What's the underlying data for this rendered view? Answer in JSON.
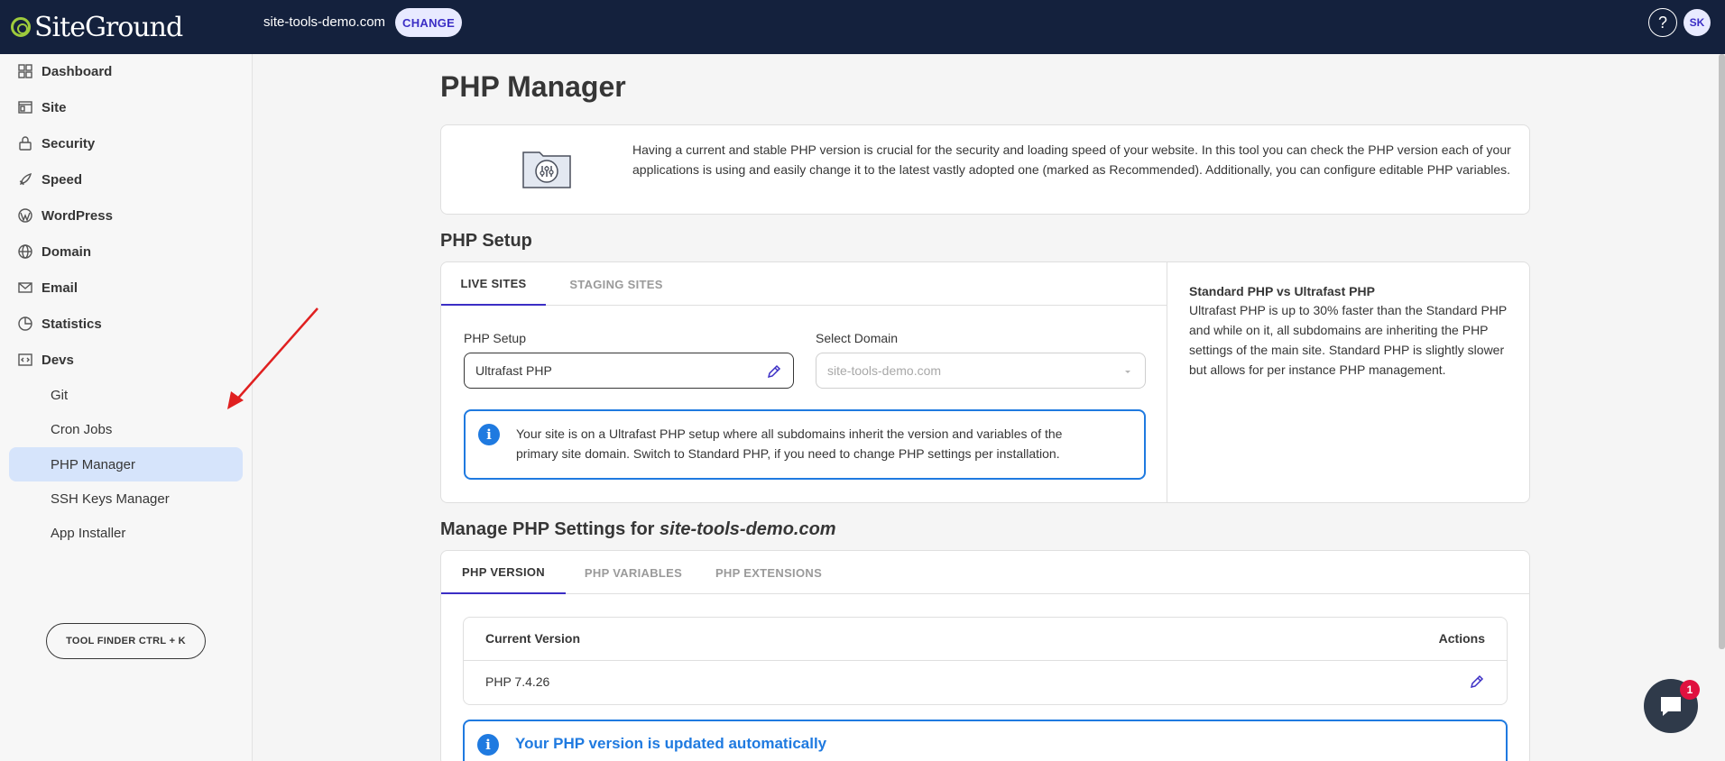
{
  "header": {
    "logo_text": "SiteGround",
    "site_name": "site-tools-demo.com",
    "change_label": "CHANGE",
    "help_label": "?",
    "avatar_initials": "SK"
  },
  "sidebar": {
    "items": [
      {
        "label": "Dashboard",
        "icon": "dashboard-icon"
      },
      {
        "label": "Site",
        "icon": "site-icon"
      },
      {
        "label": "Security",
        "icon": "lock-icon"
      },
      {
        "label": "Speed",
        "icon": "rocket-icon"
      },
      {
        "label": "WordPress",
        "icon": "wordpress-icon"
      },
      {
        "label": "Domain",
        "icon": "globe-icon"
      },
      {
        "label": "Email",
        "icon": "envelope-icon"
      },
      {
        "label": "Statistics",
        "icon": "pie-chart-icon"
      },
      {
        "label": "Devs",
        "icon": "code-icon"
      }
    ],
    "sub_items": [
      "Git",
      "Cron Jobs",
      "PHP Manager",
      "SSH Keys Manager",
      "App Installer"
    ],
    "active_sub_item": "PHP Manager",
    "tool_finder_label": "TOOL FINDER CTRL + K"
  },
  "page": {
    "title": "PHP Manager",
    "intro": "Having a current and stable PHP version is crucial for the security and loading speed of your website. In this tool you can check the PHP version each of your applications is using and easily change it to the latest vastly adopted one (marked as Recommended). Additionally, you can configure editable PHP variables."
  },
  "setup": {
    "section_title": "PHP Setup",
    "tabs": [
      "LIVE SITES",
      "STAGING SITES"
    ],
    "active_tab": "LIVE SITES",
    "php_setup_label": "PHP Setup",
    "php_setup_value": "Ultrafast PHP",
    "select_domain_label": "Select Domain",
    "select_domain_value": "site-tools-demo.com",
    "info_line1": "Your site is on a Ultrafast PHP setup where all subdomains inherit the version and variables of the",
    "info_line2": "primary site domain. Switch to Standard PHP, if you need to change PHP settings per installation.",
    "side_title": "Standard PHP vs Ultrafast PHP",
    "side_text": "Ultrafast PHP is up to 30% faster than the Standard PHP and while on it, all subdomains are inheriting the PHP settings of the main site. Standard PHP is slightly slower but allows for per instance PHP management."
  },
  "manage": {
    "title_prefix": "Manage PHP Settings for",
    "title_domain": "site-tools-demo.com",
    "tabs": [
      "PHP VERSION",
      "PHP VARIABLES",
      "PHP EXTENSIONS"
    ],
    "active_tab": "PHP VERSION",
    "col_version": "Current Version",
    "col_actions": "Actions",
    "current_version": "PHP 7.4.26",
    "auto_update_text": "Your PHP version is updated automatically"
  },
  "chat": {
    "badge_count": "1"
  },
  "colors": {
    "topbar": "#14213d",
    "accent": "#3b2ec5",
    "info_blue": "#1f7ae0",
    "active_nav_bg": "#d6e4fb",
    "annotation_arrow": "#e02020"
  }
}
